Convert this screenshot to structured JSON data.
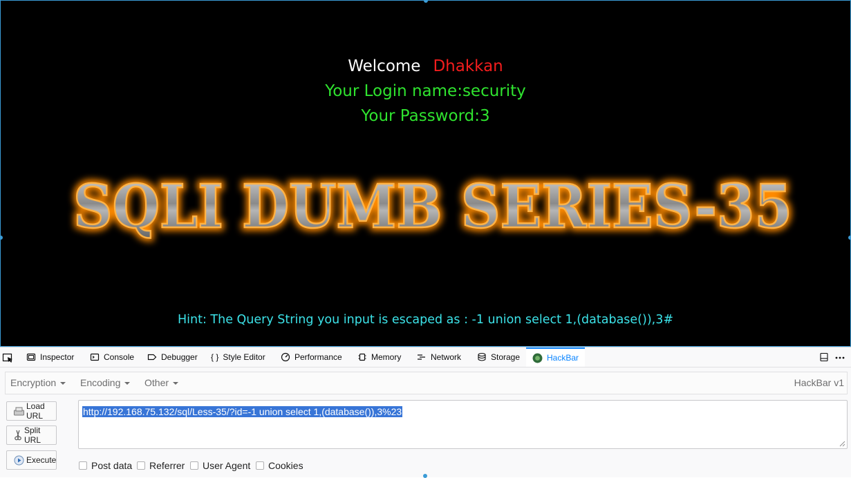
{
  "page": {
    "welcome_label": "Welcome",
    "username": "Dhakkan",
    "login_line": "Your Login name:security",
    "password_line": "Your Password:3",
    "banner_text": "SQLI DUMB SERIES-35",
    "hint": "Hint: The Query String you input is escaped as : -1 union select 1,(database()),3#",
    "colors": {
      "background": "#000000",
      "welcome": "#ffffff",
      "username": "#f21d1d",
      "credentials": "#2fe32f",
      "hint": "#3ce2e8",
      "banner_glow": "#ff9a1a"
    }
  },
  "devtools": {
    "tabs": [
      {
        "label": "Inspector",
        "icon": "inspector-icon"
      },
      {
        "label": "Console",
        "icon": "console-icon"
      },
      {
        "label": "Debugger",
        "icon": "debugger-icon"
      },
      {
        "label": "Style Editor",
        "icon": "braces-icon"
      },
      {
        "label": "Performance",
        "icon": "performance-icon"
      },
      {
        "label": "Memory",
        "icon": "memory-icon"
      },
      {
        "label": "Network",
        "icon": "network-icon"
      },
      {
        "label": "Storage",
        "icon": "storage-icon"
      },
      {
        "label": "HackBar",
        "icon": "hackbar-icon",
        "active": true
      }
    ]
  },
  "hackbar": {
    "menus": [
      "Encryption",
      "Encoding",
      "Other"
    ],
    "title": "HackBar v1",
    "buttons": {
      "load": "Load URL",
      "split": "Split URL",
      "execute": "Execute"
    },
    "url": "http://192.168.75.132/sql/Less-35/?id=-1 union select 1,(database()),3%23",
    "checkboxes": [
      "Post data",
      "Referrer",
      "User Agent",
      "Cookies"
    ]
  }
}
